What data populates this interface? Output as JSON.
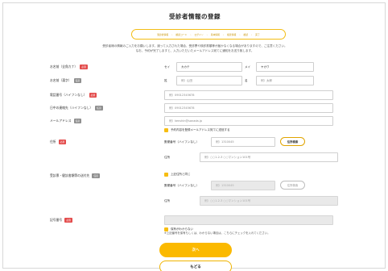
{
  "page": {
    "title": "受診者情報の登録"
  },
  "stepper": {
    "steps": [
      "受診者情報",
      "確認コード",
      "ログイン",
      "基本情報",
      "検査情報",
      "確認",
      "完了"
    ]
  },
  "notice": {
    "line1": "受診者様の情報のご入力をお願いします。誤って入力された場合、受診票や検診書類等が届かなくなる場合がありますので、ご注意ください。",
    "line2": "なお、予約が完了しますと、入力いただいたメールアドレス宛てに通知をお送り致します。"
  },
  "badges": {
    "required": "必須",
    "optional": "任意"
  },
  "form": {
    "name_kana": {
      "label": "お名前（全角カナ）",
      "sei_label": "セイ",
      "sei_value": "カカテ",
      "mei_label": "メイ",
      "mei_value": "ヤカワ"
    },
    "name_kanji": {
      "label": "お名前（漢字）",
      "sei_label": "姓",
      "sei_placeholder": "例）山田",
      "mei_label": "名",
      "mei_placeholder": "例）太郎"
    },
    "phone": {
      "label": "電話番号（ハイフンなし）",
      "placeholder": "例）09012345678"
    },
    "daytime_phone": {
      "label": "日中の連絡先（ハイフンなし）",
      "placeholder": "例）09012345678"
    },
    "email": {
      "label": "メールアドレス",
      "placeholder": "例）kenshin@sanada.jp",
      "checkbox_label": "予約内容を登録メールアドレス宛てに送信する"
    },
    "address": {
      "label": "住所",
      "zip_label": "郵便番号（ハイフンなし）",
      "zip_placeholder": "例）1310045",
      "search_button": "住所検索",
      "address_label": "住所",
      "address_placeholder": "例）○○1-2-3 ○○マンション101号"
    },
    "mailing_address": {
      "label": "受診票・健診書類等の送付先",
      "same_checkbox": "上記住所と同じ",
      "zip_label": "郵便番号（ハイフンなし）",
      "zip_placeholder": "例）1310045",
      "search_button": "住所検索",
      "address_label": "住所",
      "address_placeholder": "例）○○1-2-3 ○○マンション101号"
    },
    "insurance": {
      "label": "記号番号",
      "unknown_checkbox": "保有がわからない",
      "note": "※上記番号を保有もしくは、わからない場合は、こちらにチェックを入れてください。"
    }
  },
  "buttons": {
    "next": "次へ",
    "back": "もどる"
  },
  "colors": {
    "accent": "#fbb900",
    "required": "#e34b4b",
    "optional": "#8f8f8f"
  }
}
